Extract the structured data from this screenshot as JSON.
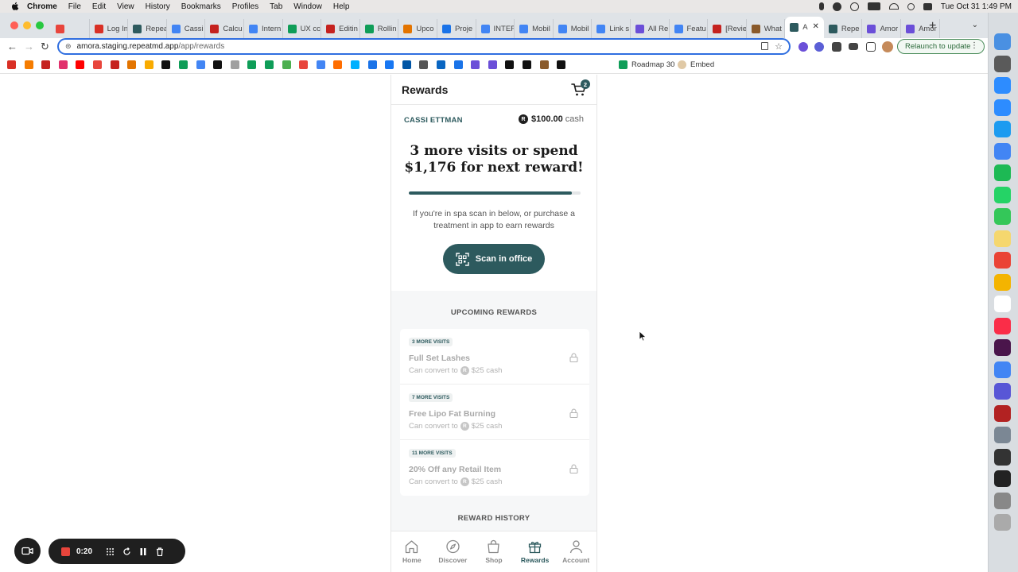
{
  "menubar": {
    "app_name": "Chrome",
    "items": [
      "File",
      "Edit",
      "View",
      "History",
      "Bookmarks",
      "Profiles",
      "Tab",
      "Window",
      "Help"
    ],
    "clock": "Tue Oct 31  1:49 PM"
  },
  "tabs": [
    {
      "label": "",
      "color": "#e8453c"
    },
    {
      "label": "Log In",
      "color": "#d93025"
    },
    {
      "label": "Repea",
      "color": "#2d5a5e"
    },
    {
      "label": "Cassi",
      "color": "#4285f4"
    },
    {
      "label": "Calcu",
      "color": "#c5221f"
    },
    {
      "label": "Intern",
      "color": "#4285f4"
    },
    {
      "label": "UX cc",
      "color": "#0f9d58"
    },
    {
      "label": "Editin",
      "color": "#c5221f"
    },
    {
      "label": "Rollin",
      "color": "#0f9d58"
    },
    {
      "label": "Upco",
      "color": "#e37400"
    },
    {
      "label": "Proje",
      "color": "#1a73e8"
    },
    {
      "label": "INTEF",
      "color": "#4285f4"
    },
    {
      "label": "Mobil",
      "color": "#4285f4"
    },
    {
      "label": "Mobil",
      "color": "#4285f4"
    },
    {
      "label": "Link s",
      "color": "#4285f4"
    },
    {
      "label": "All Re",
      "color": "#6b4fd8"
    },
    {
      "label": "Featu",
      "color": "#4285f4"
    },
    {
      "label": "[Revie",
      "color": "#c5221f"
    },
    {
      "label": "What",
      "color": "#8a5a2b"
    },
    {
      "label": "A",
      "color": "#2d5a5e",
      "active": true
    },
    {
      "label": "Repe",
      "color": "#2d5a5e"
    },
    {
      "label": "Amor",
      "color": "#6b4fd8"
    },
    {
      "label": "Amor",
      "color": "#6b4fd8"
    }
  ],
  "address": {
    "host": "amora.staging.repeatmd.app",
    "path": "/app/rewards"
  },
  "relaunch_label": "Relaunch to update",
  "bookmarks": {
    "roadmap_label": "Roadmap 30",
    "embed_label": "Embed"
  },
  "app": {
    "title": "Rewards",
    "cart_count": "2",
    "member_name": "CASSI ETTMAN",
    "balance_amount": "$100.00",
    "balance_unit": "cash",
    "coin_letter": "R",
    "headline_line1": "3 more visits or spend",
    "headline_line2": "$1,176 for next reward!",
    "progress": 0.95,
    "hint": "If you're in spa scan in below, or purchase a treatment in app to earn rewards",
    "scan_label": "Scan in office",
    "upcoming_title": "UPCOMING REWARDS",
    "history_title": "REWARD HISTORY",
    "rewards": [
      {
        "badge": "3 MORE VISITS",
        "name": "Full Set Lashes",
        "convert_prefix": "Can convert to",
        "convert_value": "$25 cash"
      },
      {
        "badge": "7 MORE VISITS",
        "name": "Free Lipo Fat Burning",
        "convert_prefix": "Can convert to",
        "convert_value": "$25 cash"
      },
      {
        "badge": "11 MORE VISITS",
        "name": "20% Off any Retail Item",
        "convert_prefix": "Can convert to",
        "convert_value": "$25 cash"
      }
    ],
    "nav": [
      {
        "label": "Home",
        "icon": "home-icon"
      },
      {
        "label": "Discover",
        "icon": "compass-icon"
      },
      {
        "label": "Shop",
        "icon": "shopping-bag-icon"
      },
      {
        "label": "Rewards",
        "icon": "gift-icon",
        "active": true
      },
      {
        "label": "Account",
        "icon": "person-icon"
      }
    ]
  },
  "recorder": {
    "time": "0:20"
  },
  "colors": {
    "brand": "#2d5a5e",
    "omnibox_focus": "#2f6ee0",
    "record": "#e8453c"
  }
}
